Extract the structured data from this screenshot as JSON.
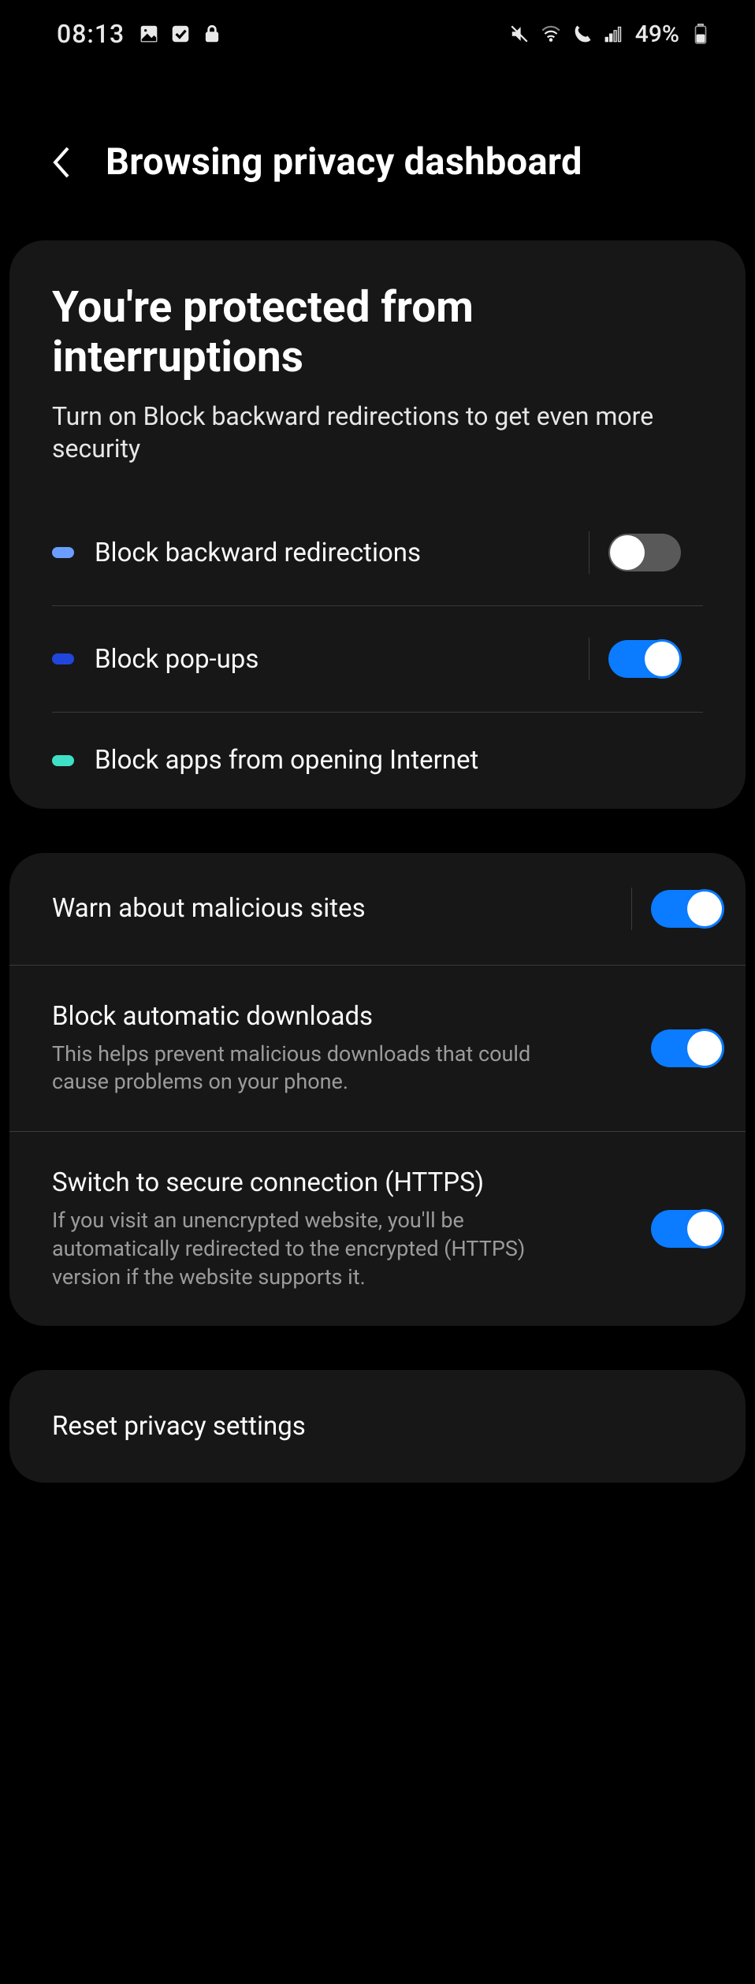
{
  "status": {
    "time": "08:13",
    "battery": "49%"
  },
  "header": {
    "title": "Browsing privacy dashboard"
  },
  "hero": {
    "heading": "You're protected from interruptions",
    "subheading": "Turn on Block backward redirections to get even more security"
  },
  "section1": {
    "items": [
      {
        "label": "Block backward redirections",
        "toggle": "off",
        "dot": "blue"
      },
      {
        "label": "Block pop-ups",
        "toggle": "on",
        "dot": "dblue"
      },
      {
        "label": "Block apps from opening Internet",
        "toggle": null,
        "dot": "teal"
      }
    ]
  },
  "section2": {
    "items": [
      {
        "label": "Warn about malicious sites",
        "sub": "",
        "toggle": "on"
      },
      {
        "label": "Block automatic downloads",
        "sub": "This helps prevent malicious downloads that could cause problems on your phone.",
        "toggle": "on"
      },
      {
        "label": "Switch to secure connection (HTTPS)",
        "sub": "If you visit an unencrypted website, you'll be automatically redirected to the encrypted (HTTPS) version if the website supports it.",
        "toggle": "on"
      }
    ]
  },
  "section3": {
    "reset": "Reset privacy settings"
  }
}
